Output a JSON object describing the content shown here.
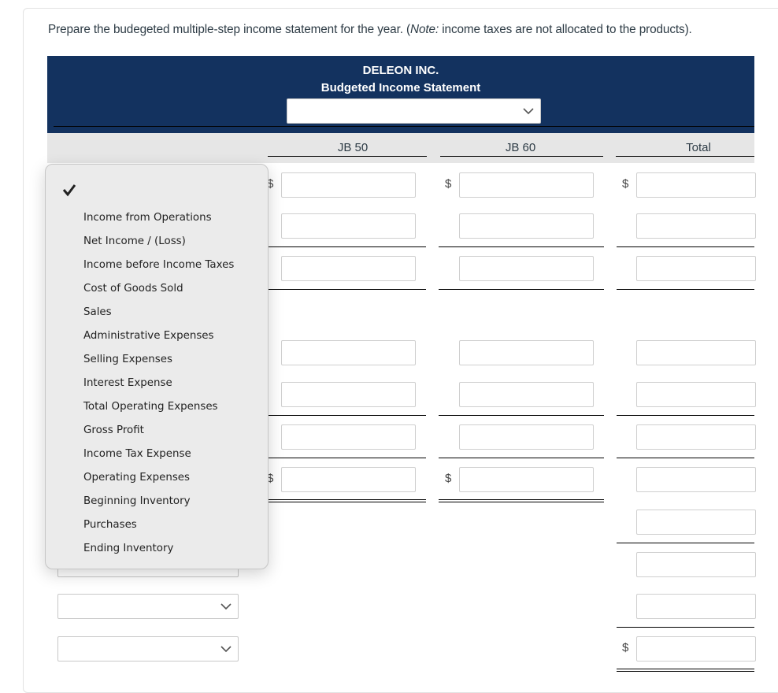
{
  "instruction": {
    "before": "Prepare the budegeted multiple-step income statement for the year. (",
    "note_label": "Note:",
    "after": " income taxes are not allocated to the products)."
  },
  "statement": {
    "company": "DELEON INC.",
    "title": "Budgeted Income Statement",
    "period_select": {
      "value": "",
      "icon": "chevron-down-icon"
    }
  },
  "columns": [
    "JB 50",
    "JB 60",
    "Total"
  ],
  "currency_symbol": "$",
  "dropdown": {
    "selected_icon": "checkmark-icon",
    "selected_value": "",
    "options": [
      "Income from Operations",
      "Net Income / (Loss)",
      "Income before Income Taxes",
      "Cost of Goods Sold",
      "Sales",
      "Administrative Expenses",
      "Selling Expenses",
      "Interest Expense",
      "Total Operating Expenses",
      "Gross Profit",
      "Income Tax Expense",
      "Operating Expenses",
      "Beginning Inventory",
      "Purchases",
      "Ending Inventory"
    ]
  },
  "rows": [
    {
      "label": "",
      "jb50": "",
      "jb60": "",
      "total": ""
    },
    {
      "label": "",
      "jb50": "",
      "jb60": "",
      "total": ""
    },
    {
      "label": "",
      "jb50": "",
      "jb60": "",
      "total": ""
    },
    {
      "label": "",
      "jb50": "",
      "jb60": "",
      "total": ""
    },
    {
      "label": "",
      "jb50": "",
      "jb60": "",
      "total": ""
    },
    {
      "label": "",
      "jb50": "",
      "jb60": "",
      "total": ""
    },
    {
      "label": "",
      "jb50": "",
      "jb60": "",
      "total": ""
    },
    {
      "label": "",
      "total": ""
    },
    {
      "label": "",
      "total": ""
    },
    {
      "label": "",
      "total": ""
    },
    {
      "label": "",
      "total": ""
    }
  ]
}
